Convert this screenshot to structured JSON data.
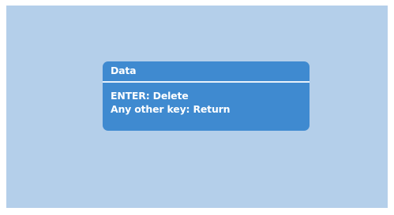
{
  "dialog": {
    "title": "Data",
    "lines": [
      "ENTER: Delete",
      "Any other key: Return"
    ]
  },
  "colors": {
    "screen_background": "#b4cfea",
    "dialog_background": "#3f8ad0",
    "dialog_text": "#ffffff",
    "divider": "#e8f1fb"
  }
}
